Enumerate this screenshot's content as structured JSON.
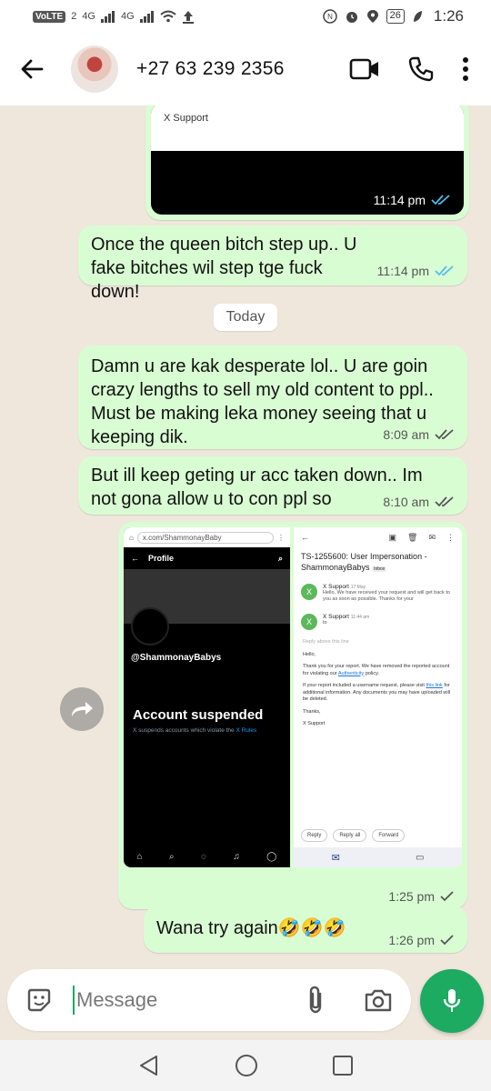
{
  "status_bar": {
    "volte": "VoLTE",
    "sim": "2",
    "net1": "4G",
    "net2": "4G",
    "battery": "26",
    "time": "1:26"
  },
  "header": {
    "contact": "+27 63 239 2356",
    "icons": [
      "back-arrow-icon",
      "video-call-icon",
      "phone-icon",
      "more-vert-icon"
    ]
  },
  "chat": {
    "image_msg_1": {
      "caption_preview": "X Support",
      "time": "11:14 pm",
      "status": "read"
    },
    "msg_1": {
      "text": "Once the queen bitch step up.. U fake bitches wil step tge fuck down!",
      "time": "11:14 pm",
      "status": "read"
    },
    "date_divider": "Today",
    "msg_2": {
      "text": "Damn u are kak desperate lol.. U are goin crazy lengths to sell my old content to ppl.. Must be making leka money seeing that u keeping dik.",
      "time": "8:09 am",
      "status": "delivered"
    },
    "msg_3": {
      "text": "But ill keep geting ur acc taken down.. Im not gona allow u to con ppl so",
      "time": "8:10 am",
      "status": "delivered"
    },
    "image_msg_2": {
      "time": "1:25 pm",
      "status": "sent",
      "left_shot": {
        "url": "x.com/ShammonayBaby",
        "title": "Profile",
        "handle": "@ShammonayBabys",
        "headline": "Account suspended",
        "sub": "X suspends accounts which violate the",
        "sub_link": "X Rules"
      },
      "right_shot": {
        "subject": "TS-1255600: User Impersonation - ShammonayBabys",
        "inbox_tag": "Inbox",
        "from1": "X Support",
        "date1": "17 May",
        "snippet1": "Hello, We have received your request and will get back to you as soon as possible. Thanks for your",
        "from2": "X Support",
        "time2": "11:44 am",
        "to2": "to",
        "reply_above": "Reply above this line",
        "hello": "Hello,",
        "body1": "Thank you for your report. We have removed the reported account for violating our",
        "body1_link": "Authenticity",
        "body1_end": "policy.",
        "body2": "If your report included a username request, please visit",
        "body2_link": "this link",
        "body2_end": "for additional information. Any documents you may have uploaded will be deleted.",
        "thanks": "Thanks,",
        "sign": "X Support",
        "reply": "Reply",
        "reply_all": "Reply all",
        "forward": "Forward"
      }
    },
    "msg_4": {
      "text": "Wana try again",
      "emoji": "🤣🤣🤣",
      "time": "1:26 pm",
      "status": "sent"
    }
  },
  "input": {
    "placeholder": "Message"
  },
  "colors": {
    "bubble_out": "#d9fdd3",
    "wallpaper": "#efe7dc",
    "accent": "#1daa61",
    "read_tick": "#53bdeb"
  }
}
